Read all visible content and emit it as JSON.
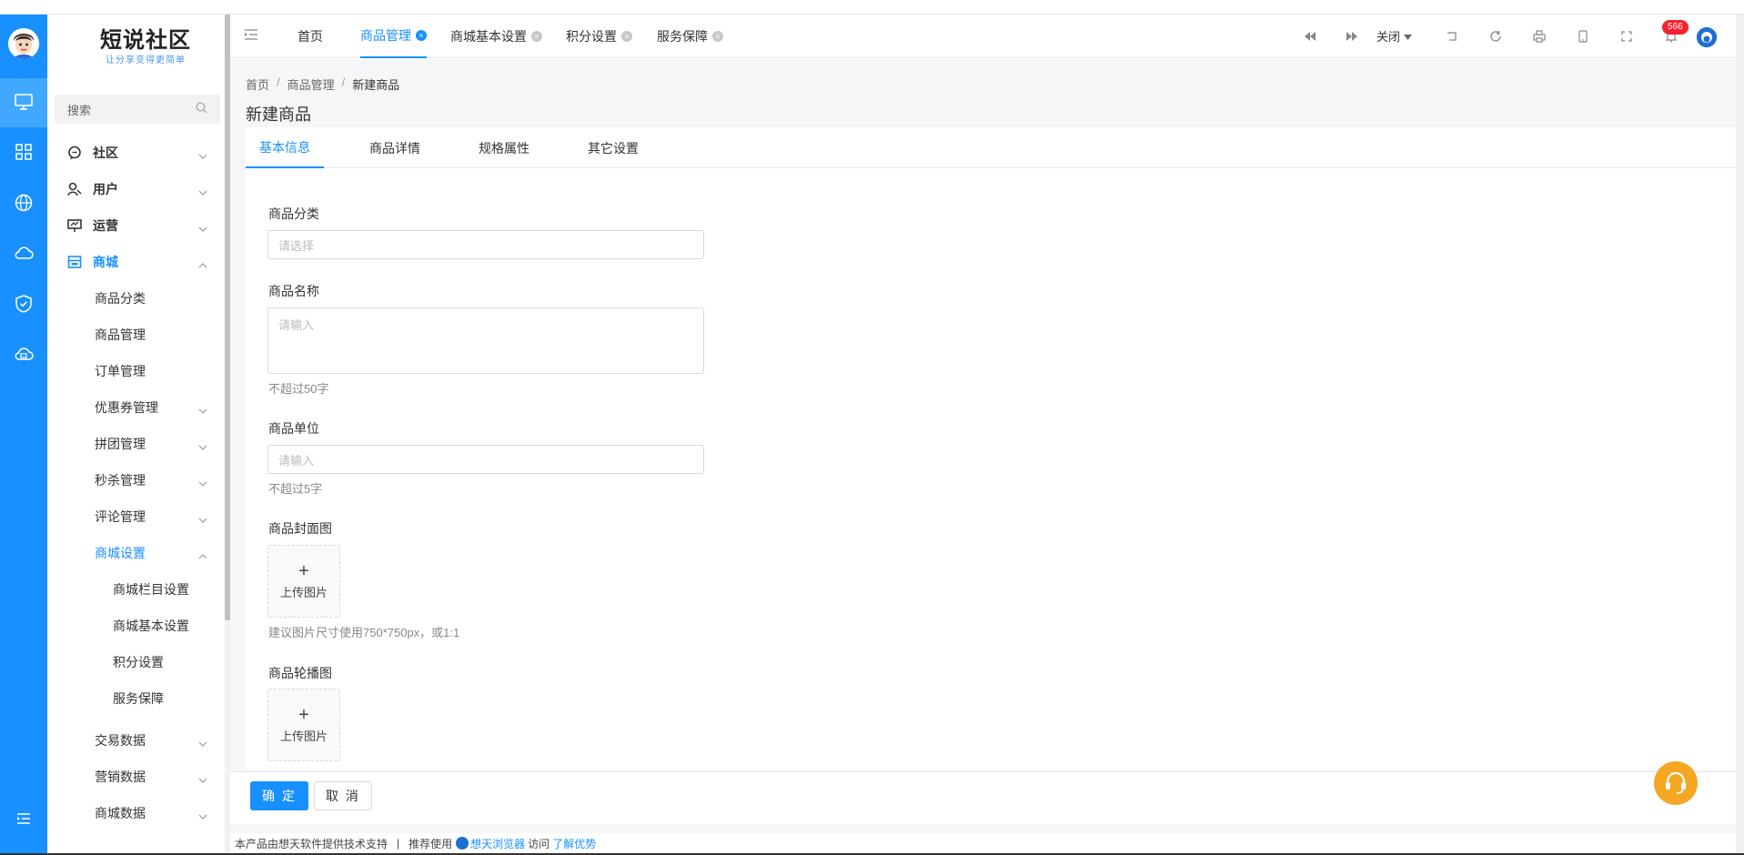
{
  "brand": {
    "title": "短说社区",
    "subtitle": "让分享变得更简单"
  },
  "search": {
    "placeholder": "搜索"
  },
  "menu": {
    "groups": [
      {
        "label": "社区"
      },
      {
        "label": "用户"
      },
      {
        "label": "运营"
      },
      {
        "label": "商城"
      }
    ],
    "mall_items": [
      {
        "label": "商品分类"
      },
      {
        "label": "商品管理"
      },
      {
        "label": "订单管理"
      },
      {
        "label": "优惠券管理"
      },
      {
        "label": "拼团管理"
      },
      {
        "label": "秒杀管理"
      },
      {
        "label": "评论管理"
      },
      {
        "label": "商城设置"
      }
    ],
    "settings_items": [
      {
        "label": "商城栏目设置"
      },
      {
        "label": "商城基本设置"
      },
      {
        "label": "积分设置"
      },
      {
        "label": "服务保障"
      }
    ],
    "data_items": [
      {
        "label": "交易数据"
      },
      {
        "label": "营销数据"
      },
      {
        "label": "商城数据"
      }
    ]
  },
  "topbar": {
    "tabs": [
      {
        "label": "首页"
      },
      {
        "label": "商品管理"
      },
      {
        "label": "商城基本设置"
      },
      {
        "label": "积分设置"
      },
      {
        "label": "服务保障"
      }
    ],
    "close_label": "关闭",
    "notification_count": "566"
  },
  "breadcrumb": {
    "home": "首页",
    "parent": "商品管理",
    "current": "新建商品"
  },
  "page_title": "新建商品",
  "form_tabs": [
    {
      "label": "基本信息"
    },
    {
      "label": "商品详情"
    },
    {
      "label": "规格属性"
    },
    {
      "label": "其它设置"
    }
  ],
  "form": {
    "category": {
      "label": "商品分类",
      "placeholder": "请选择"
    },
    "name": {
      "label": "商品名称",
      "placeholder": "请输入",
      "hint": "不超过50字"
    },
    "unit": {
      "label": "商品单位",
      "placeholder": "请输入",
      "hint": "不超过5字"
    },
    "cover": {
      "label": "商品封面图",
      "upload_label": "上传图片",
      "hint": "建议图片尺寸使用750*750px，或1:1"
    },
    "carousel": {
      "label": "商品轮播图",
      "upload_label": "上传图片"
    }
  },
  "actions": {
    "confirm": "确 定",
    "cancel": "取 消"
  },
  "footer": {
    "support_text": "本产品由想天软件提供技术支持",
    "separator": "|",
    "recommend": "推荐使用",
    "browser": "想天浏览器",
    "visit": "访问",
    "learn_more": "了解优势"
  },
  "colors": {
    "primary": "#1890ff",
    "rail": "#1890ff",
    "badge": "#f5222d",
    "support": "#f5a623"
  }
}
